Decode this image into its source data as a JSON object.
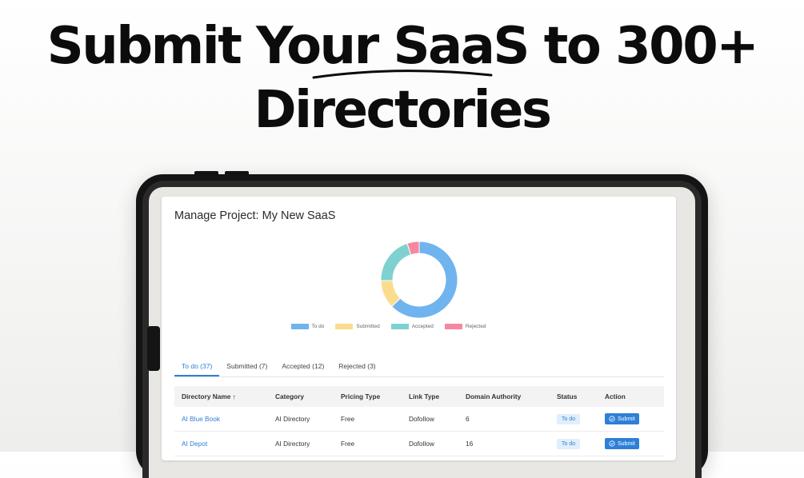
{
  "headline": {
    "line1": "Submit Your SaaS to 300+",
    "line2": "Directories"
  },
  "project": {
    "title": "Manage Project: My New SaaS"
  },
  "chart_data": {
    "type": "pie",
    "categories": [
      "To do",
      "Submitted",
      "Accepted",
      "Rejected"
    ],
    "values": [
      37,
      7,
      12,
      3
    ],
    "colors": [
      "#6fb4ee",
      "#fbdc8f",
      "#7fd1cf",
      "#f7869f"
    ],
    "legend_position": "bottom"
  },
  "tabs": [
    {
      "label": "To do",
      "count": "(37)",
      "active": true
    },
    {
      "label": "Submitted",
      "count": "(7)",
      "active": false
    },
    {
      "label": "Accepted",
      "count": "(12)",
      "active": false
    },
    {
      "label": "Rejected",
      "count": "(3)",
      "active": false
    }
  ],
  "table": {
    "headers": [
      "Directory Name ↑",
      "Category",
      "Pricing Type",
      "Link Type",
      "Domain Authority",
      "Status",
      "Action"
    ],
    "rows": [
      {
        "name": "AI Blue Book",
        "category": "AI Directory",
        "pricing": "Free",
        "link": "Dofollow",
        "da": "6",
        "status": "To do",
        "action": "Submit"
      },
      {
        "name": "AI Depot",
        "category": "AI Directory",
        "pricing": "Free",
        "link": "Dofollow",
        "da": "16",
        "status": "To do",
        "action": "Submit"
      }
    ]
  },
  "colors": {
    "accent": "#2e7fd6",
    "badge_bg": "#e2eefb",
    "device": "#141414"
  }
}
